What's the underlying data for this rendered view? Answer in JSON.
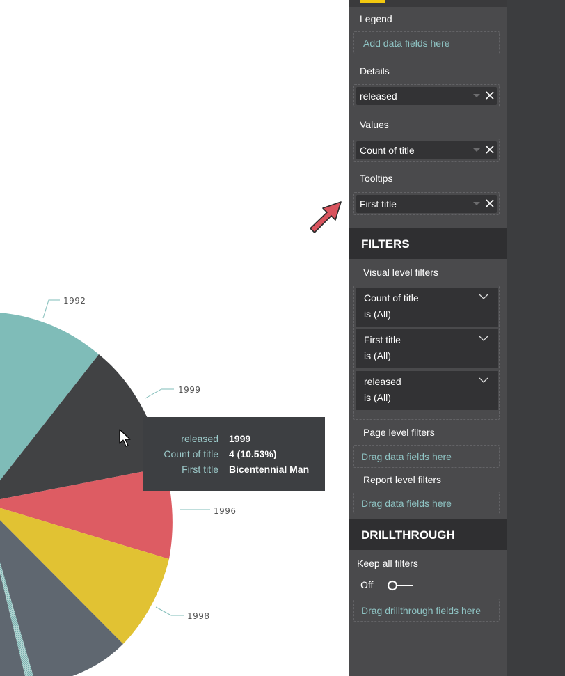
{
  "chart": {
    "slice_labels": [
      "1992",
      "1999",
      "1996",
      "1998"
    ],
    "colors": {
      "slice_teal": "#7fbcb8",
      "slice_dark": "#414244",
      "slice_red": "#dd5c63",
      "slice_yellow": "#e1c233",
      "slice_slate": "#5f6770",
      "slice_hatch": "#9fc5c5"
    }
  },
  "tooltip": {
    "rows": [
      {
        "key": "released",
        "value": "1999"
      },
      {
        "key": "Count of title",
        "value": "4 (10.53%)"
      },
      {
        "key": "First title",
        "value": "Bicentennial Man"
      }
    ]
  },
  "fields_pane": {
    "legend": {
      "title": "Legend",
      "placeholder": "Add data fields here"
    },
    "details": {
      "title": "Details",
      "field": "released"
    },
    "values": {
      "title": "Values",
      "field": "Count of title"
    },
    "tooltips": {
      "title": "Tooltips",
      "field": "First title"
    }
  },
  "filters": {
    "header": "FILTERS",
    "visual_level": {
      "title": "Visual level filters",
      "cards": [
        {
          "name": "Count of title",
          "state": "is (All)"
        },
        {
          "name": "First title",
          "state": "is (All)"
        },
        {
          "name": "released",
          "state": "is (All)"
        }
      ]
    },
    "page_level": {
      "title": "Page level filters",
      "placeholder": "Drag data fields here"
    },
    "report_level": {
      "title": "Report level filters",
      "placeholder": "Drag data fields here"
    }
  },
  "drillthrough": {
    "header": "DRILLTHROUGH",
    "keep_all_filters": "Keep all filters",
    "toggle_state": "Off",
    "placeholder": "Drag drillthrough fields here"
  },
  "icons": {
    "cursor": "mouse-pointer-icon",
    "arrow": "red-arrow-icon",
    "remove": "close-icon",
    "expand": "chevron-down-icon",
    "dropdown": "caret-down-icon",
    "toggle": "toggle-switch-icon"
  },
  "accent": {
    "tab_indicator": "#f2c80f",
    "arrow": "#d9545e",
    "teal_text": "#8fc4c4"
  }
}
